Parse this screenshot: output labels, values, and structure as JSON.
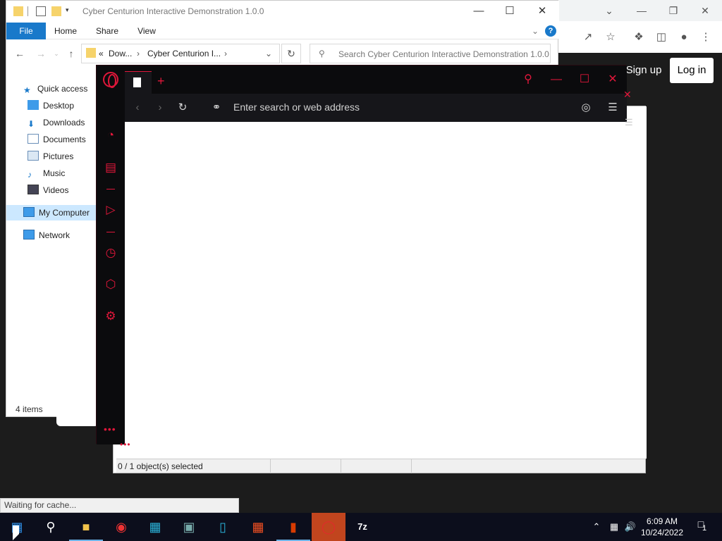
{
  "chrome": {
    "signup": "Sign up",
    "login": "Log in"
  },
  "explorer": {
    "title": "Cyber Centurion Interactive Demonstration 1.0.0",
    "ribbon": [
      "File",
      "Home",
      "Share",
      "View"
    ],
    "help": "?",
    "address": {
      "prefix": "«",
      "crumb1": "Dow...",
      "crumb2": "Cyber Centurion I..."
    },
    "search_placeholder": "Search Cyber Centurion Interactive Demonstration 1.0.0",
    "nav": {
      "quick_access": "Quick access",
      "desktop": "Desktop",
      "downloads": "Downloads",
      "documents": "Documents",
      "pictures": "Pictures",
      "music": "Music",
      "videos": "Videos",
      "my_computer": "My Computer",
      "network": "Network"
    },
    "status": "4 items"
  },
  "sevenzip": {
    "status": "0 / 1 object(s) selected"
  },
  "opera": {
    "url_placeholder": "Enter search or web address",
    "accent": "#e0173a"
  },
  "tooltip": "Waiting for cache...",
  "taskbar": {
    "time": "6:09 AM",
    "date": "10/24/2022",
    "notification_count": "1",
    "sevenzip_label": "7z"
  }
}
